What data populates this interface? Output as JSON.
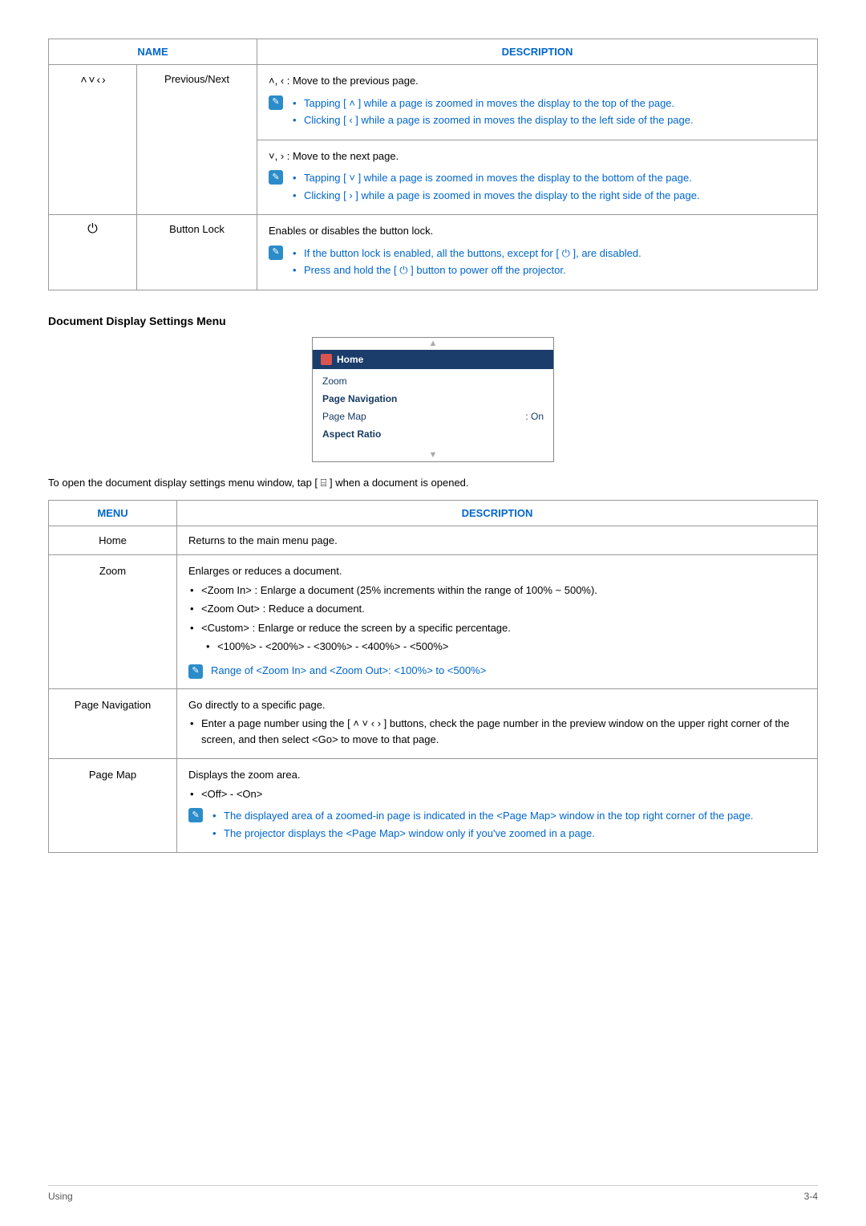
{
  "table1": {
    "headers": [
      "NAME",
      "DESCRIPTION"
    ],
    "row1": {
      "icons_label": "˄ ˅ ‹ ›",
      "name": "Previous/Next",
      "prev_intro": "˄, ‹ : Move to the previous page.",
      "prev_notes": [
        "Tapping [ ˄ ] while a page is zoomed in moves the display to the top of the page.",
        "Clicking [ ‹ ] while a page is zoomed in moves the display to the left side of the page."
      ],
      "next_intro": "˅, › : Move to the next page.",
      "next_notes": [
        "Tapping [ ˅ ] while a page is zoomed in moves the display to the bottom of the page.",
        "Clicking [ › ] while a page is zoomed in moves the display to the right side of the page."
      ]
    },
    "row2": {
      "icon": "⏻",
      "name": "Button Lock",
      "intro": "Enables or disables the button lock.",
      "notes": [
        "If the button lock is enabled, all the buttons, except for [ ⏻ ], are disabled.",
        "Press and hold the [ ⏻ ] button to power off the projector."
      ]
    }
  },
  "section_title": "Document Display Settings Menu",
  "screenshot": {
    "home": "Home",
    "items": [
      "Zoom",
      "Page Navigation",
      "Page Map",
      "Aspect Ratio"
    ],
    "page_map_value": ": On"
  },
  "open_prompt": "To open the document display settings menu window, tap [ ⌸ ] when a document is opened.",
  "table2": {
    "headers": [
      "MENU",
      "DESCRIPTION"
    ],
    "rows": {
      "home": {
        "menu": "Home",
        "desc": "Returns to the main menu page."
      },
      "zoom": {
        "menu": "Zoom",
        "intro": "Enlarges or reduces a document.",
        "items": [
          "<Zoom In> : Enlarge a document (25% increments within the range of 100% ~ 500%).",
          "<Zoom Out> : Reduce a document.",
          "<Custom> : Enlarge or reduce the screen by a specific percentage."
        ],
        "sub": "<100%> - <200%> - <300%> - <400%> - <500%>",
        "note": "Range of <Zoom In> and <Zoom Out>: <100%> to <500%>"
      },
      "pagenav": {
        "menu": "Page Navigation",
        "intro": "Go directly to a specific page.",
        "item": "Enter a page number using the [ ˄ ˅ ‹ › ] buttons, check the page number in the preview window on the upper right corner of the screen, and then select <Go> to move to that page."
      },
      "pagemap": {
        "menu": "Page Map",
        "intro": "Displays the zoom area.",
        "item": "<Off> - <On>",
        "notes": [
          "The displayed area of a zoomed-in page is indicated in the <Page Map> window in the top right corner of the page.",
          "The projector displays the <Page Map> window only if you've zoomed in a page."
        ]
      }
    }
  },
  "footer": {
    "left": "Using",
    "right": "3-4"
  }
}
